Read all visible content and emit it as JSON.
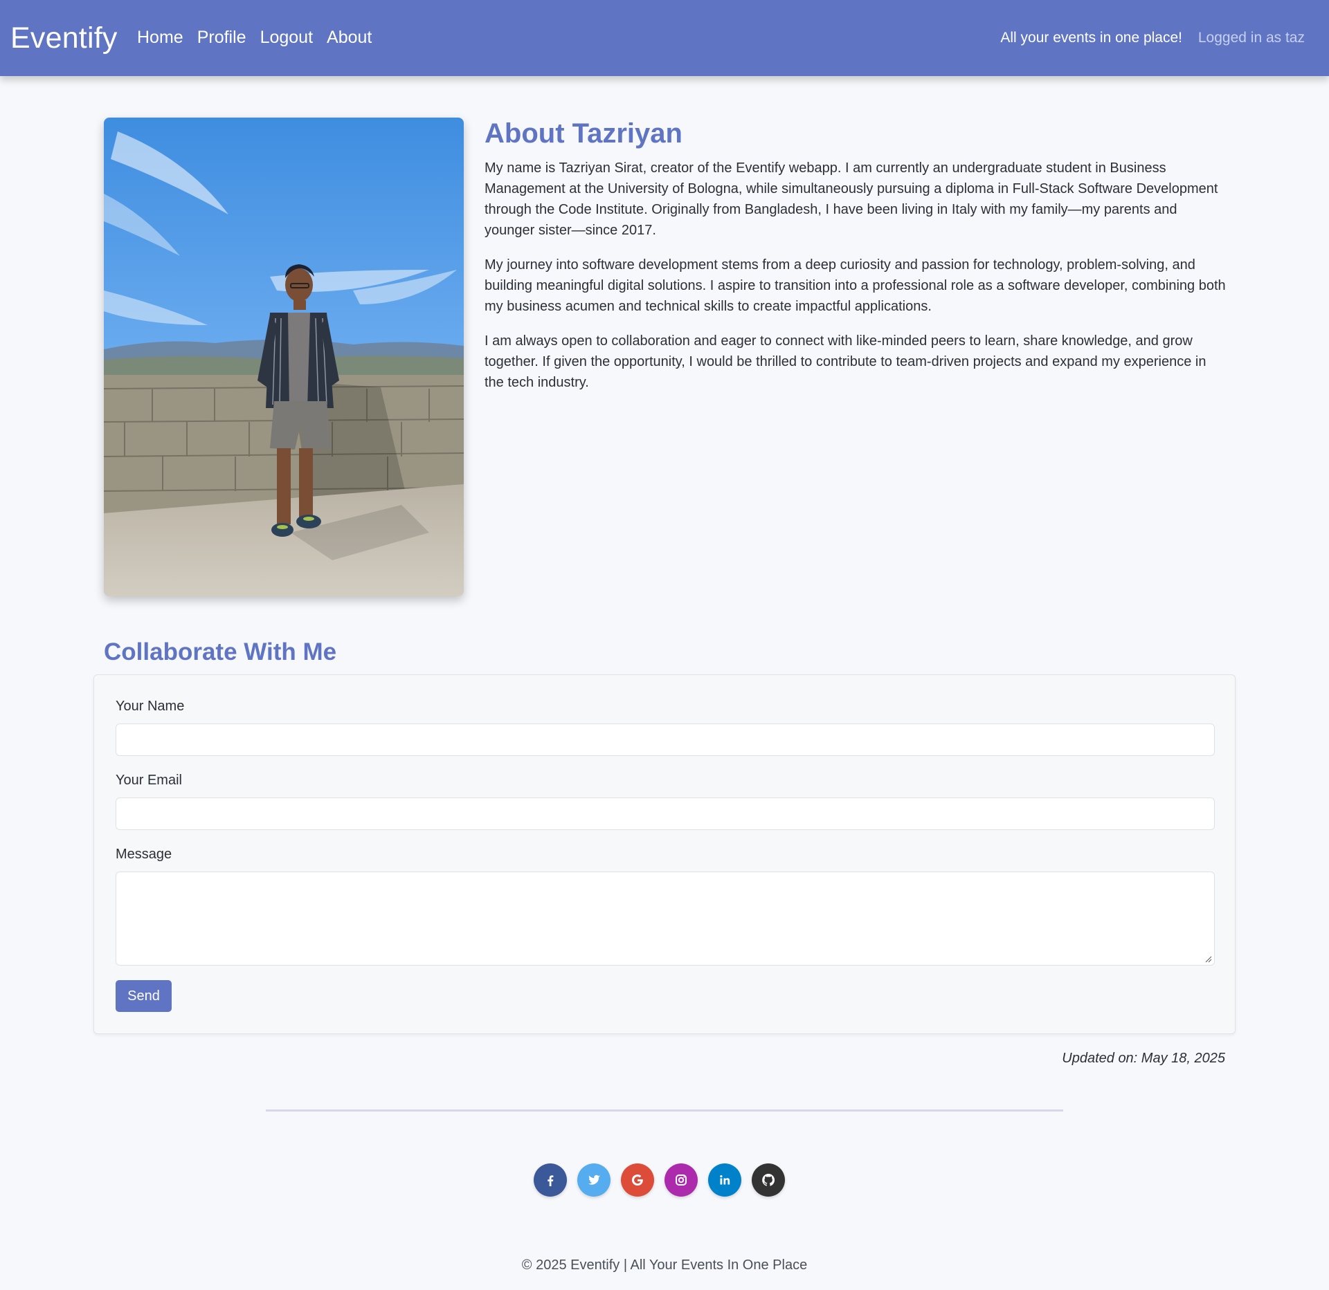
{
  "navbar": {
    "brand": "Eventify",
    "links": [
      {
        "label": "Home"
      },
      {
        "label": "Profile"
      },
      {
        "label": "Logout"
      },
      {
        "label": "About"
      }
    ],
    "tagline": "All your events in one place!",
    "logged_in": "Logged in as taz",
    "color": "#5f74c3"
  },
  "about": {
    "title": "About Tazriyan",
    "paragraphs": [
      "My name is Tazriyan Sirat, creator of the Eventify webapp. I am currently an undergraduate student in Business Management at the University of Bologna, while simultaneously pursuing a diploma in Full-Stack Software Development through the Code Institute. Originally from Bangladesh, I have been living in Italy with my family—my parents and younger sister—since 2017.",
      "My journey into software development stems from a deep curiosity and passion for technology, problem-solving, and building meaningful digital solutions. I aspire to transition into a professional role as a software developer, combining both my business acumen and technical skills to create impactful applications.",
      "I am always open to collaboration and eager to connect with like-minded peers to learn, share knowledge, and grow together. If given the opportunity, I would be thrilled to contribute to team-driven projects and expand my experience in the tech industry."
    ]
  },
  "collab": {
    "title": "Collaborate With Me",
    "name_label": "Your Name",
    "name_value": "",
    "email_label": "Your Email",
    "email_value": "",
    "message_label": "Message",
    "message_value": "",
    "send_label": "Send"
  },
  "updated": "Updated on: May 18, 2025",
  "footer": {
    "socials": [
      {
        "icon": "facebook-icon",
        "color": "#3b5998"
      },
      {
        "icon": "twitter-icon",
        "color": "#55acee"
      },
      {
        "icon": "google-icon",
        "color": "#dd4b39"
      },
      {
        "icon": "instagram-icon",
        "color": "#ac2bac"
      },
      {
        "icon": "linkedin-icon",
        "color": "#0082ca"
      },
      {
        "icon": "github-icon",
        "color": "#333333"
      }
    ],
    "copyright": "© 2025 Eventify | All Your Events In One Place"
  }
}
